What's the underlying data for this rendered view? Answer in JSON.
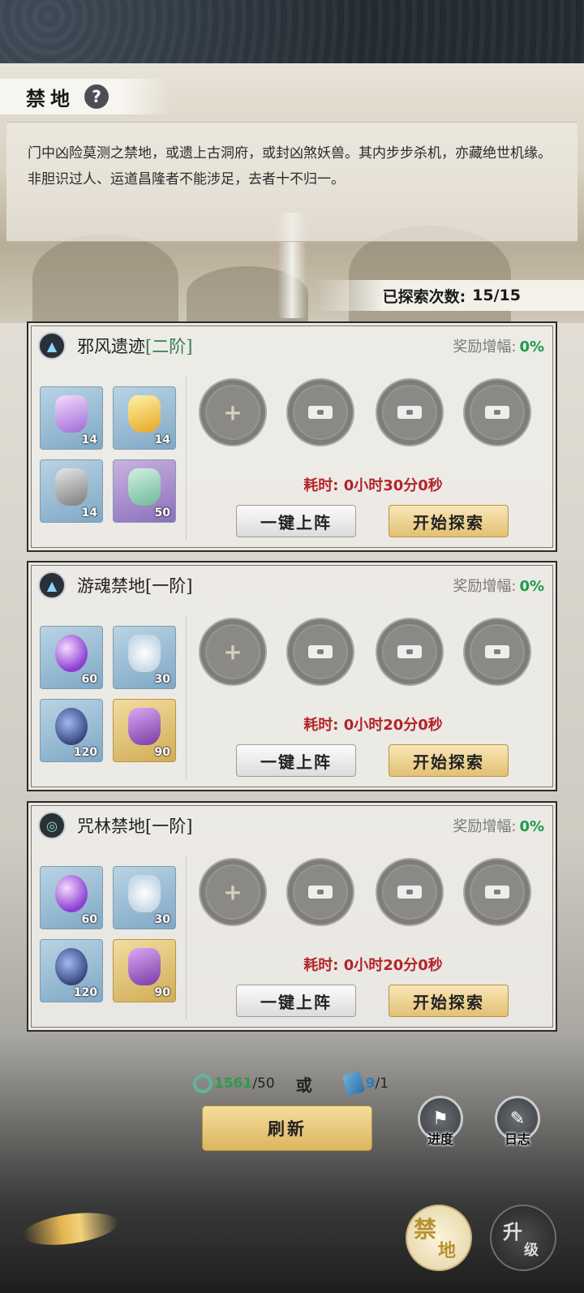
{
  "header": {
    "title": "禁地",
    "help_icon": "?"
  },
  "description": "门中凶险莫测之禁地，或遗上古洞府，或封凶煞妖兽。其内步步杀机，亦藏绝世机缘。非胆识过人、运道昌隆者不能涉足，去者十不归一。",
  "explore": {
    "label": "已探索次数:",
    "value": "15/15"
  },
  "zones": [
    {
      "name": "邪风遗迹",
      "tier": "[二阶]",
      "icon": "wind-rune-icon",
      "bonus_label": "奖励增幅:",
      "bonus_value": "0%",
      "items": [
        {
          "icon": "purple-crystal-icon",
          "count": "14",
          "bg": "blue"
        },
        {
          "icon": "flame-gold-crystal-icon",
          "count": "14",
          "bg": "blue"
        },
        {
          "icon": "grey-ore-icon",
          "count": "14",
          "bg": "blue"
        },
        {
          "icon": "potion-gourd-icon",
          "count": "50",
          "bg": "purple"
        }
      ],
      "time_label": "耗时:",
      "time_value": "0小时30分0秒",
      "btn_deploy": "一键上阵",
      "btn_start": "开始探索"
    },
    {
      "name": "游魂禁地",
      "tier": "[一阶]",
      "icon": "wind-rune-icon",
      "bonus_label": "奖励增幅:",
      "bonus_value": "0%",
      "items": [
        {
          "icon": "spirit-orb-icon",
          "count": "60",
          "bg": "blue"
        },
        {
          "icon": "white-flower-icon",
          "count": "30",
          "bg": "blue"
        },
        {
          "icon": "berry-herb-icon",
          "count": "120",
          "bg": "blue"
        },
        {
          "icon": "purple-sand-icon",
          "count": "90",
          "bg": "gold"
        }
      ],
      "time_label": "耗时:",
      "time_value": "0小时20分0秒",
      "btn_deploy": "一键上阵",
      "btn_start": "开始探索"
    },
    {
      "name": "咒林禁地",
      "tier": "[一阶]",
      "icon": "swirl-rune-icon",
      "bonus_label": "奖励增幅:",
      "bonus_value": "0%",
      "items": [
        {
          "icon": "spirit-orb-icon",
          "count": "60",
          "bg": "blue"
        },
        {
          "icon": "white-flower-icon",
          "count": "30",
          "bg": "blue"
        },
        {
          "icon": "berry-herb-icon",
          "count": "120",
          "bg": "blue"
        },
        {
          "icon": "purple-sand-icon",
          "count": "90",
          "bg": "gold"
        }
      ],
      "time_label": "耗时:",
      "time_value": "0小时20分0秒",
      "btn_deploy": "一键上阵",
      "btn_start": "开始探索"
    }
  ],
  "cost": {
    "jade_have": "1561",
    "jade_need": "/50",
    "or": "或",
    "scroll_have": "9",
    "scroll_need": "/1"
  },
  "buttons": {
    "refresh": "刷新",
    "progress": "进度",
    "log": "日志",
    "forbidden_a": "禁",
    "forbidden_b": "地",
    "upgrade_a": "升",
    "upgrade_b": "级"
  },
  "colors": {
    "green": "#1f9a4a",
    "red": "#b3242a",
    "gold": "#e2c174"
  }
}
